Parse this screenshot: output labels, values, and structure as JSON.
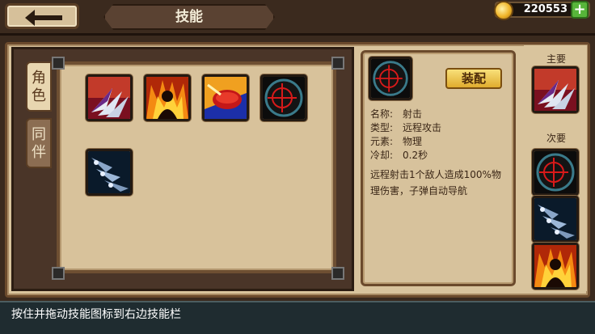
{
  "header": {
    "title": "技能",
    "gold": "220553",
    "add_label": "+"
  },
  "tabs": [
    {
      "label": "角\n色",
      "active": true
    },
    {
      "label": "同\n伴",
      "active": false
    }
  ],
  "skills": [
    {
      "name": "claw-skill"
    },
    {
      "name": "fire-aura-skill"
    },
    {
      "name": "fire-disc-skill"
    },
    {
      "name": "crosshair-skill"
    },
    {
      "name": "missiles-skill"
    }
  ],
  "detail": {
    "equip_label": "装配",
    "fields": [
      {
        "key": "名称:",
        "value": "射击"
      },
      {
        "key": "类型:",
        "value": "远程攻击"
      },
      {
        "key": "元素:",
        "value": "物理"
      },
      {
        "key": "冷却:",
        "value": "0.2秒"
      }
    ],
    "description": "远程射击1个敌人造成100%物理伤害，子弹自动导航"
  },
  "slots": {
    "primary_label": "主要",
    "secondary_label": "次要"
  },
  "hint": "按住并拖动技能图标到右边技能栏",
  "colors": {
    "parchment": "#d9c49d",
    "frame": "#6b4a2c",
    "gold_button": "#e0ac2e",
    "add_green": "#57b53a"
  }
}
